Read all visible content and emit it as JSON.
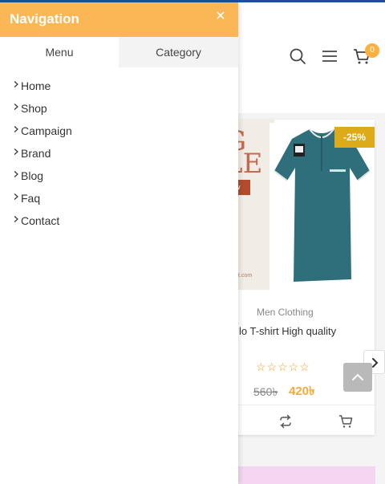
{
  "drawer": {
    "title": "Navigation",
    "tabs": [
      {
        "label": "Menu"
      },
      {
        "label": "Category"
      }
    ],
    "menu_items": [
      {
        "label": "Home"
      },
      {
        "label": "Shop"
      },
      {
        "label": "Campaign"
      },
      {
        "label": "Brand"
      },
      {
        "label": "Blog"
      },
      {
        "label": "Faq"
      },
      {
        "label": "Contact"
      }
    ]
  },
  "header": {
    "cart_count": "0"
  },
  "product": {
    "discount_badge": "-25%",
    "category": "Men Clothing",
    "title": "lo T-shirt High quality",
    "old_price": "560৳",
    "new_price": "420৳",
    "rating_stars": "☆☆☆☆☆"
  },
  "banner": {
    "letter_1": "G",
    "letter_2": "LE",
    "button_text": "ow",
    "text_1": "%",
    "text_2": "F",
    "url_text": "mart.com"
  },
  "colors": {
    "accent": "#fbb656",
    "price_new": "#f7a93b",
    "sale_badge": "#ddaa1a",
    "topline": "#1e4f9c"
  }
}
